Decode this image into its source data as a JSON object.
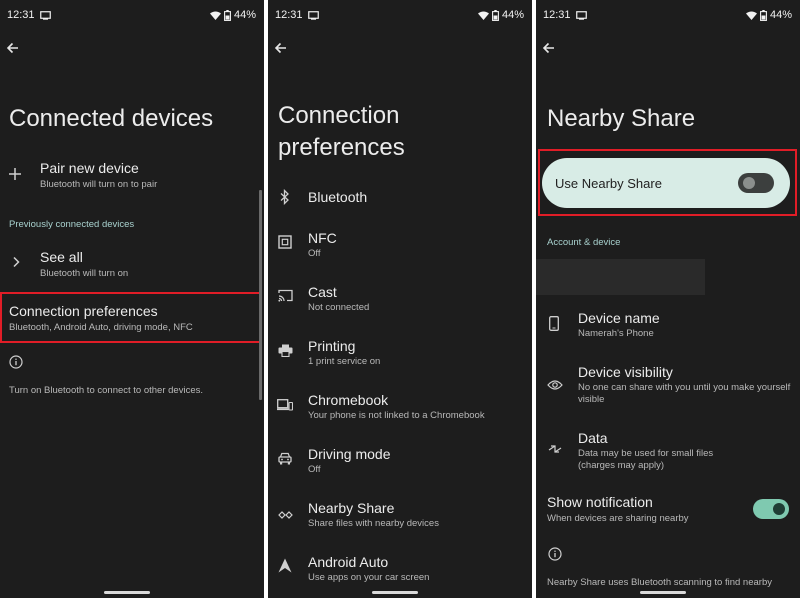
{
  "status": {
    "time": "12:31",
    "battery": "44%"
  },
  "panel1": {
    "title": "Connected devices",
    "pair": {
      "title": "Pair new device",
      "subtitle": "Bluetooth will turn on to pair"
    },
    "section_header": "Previously connected devices",
    "see_all": {
      "title": "See all",
      "subtitle": "Bluetooth will turn on"
    },
    "connection_prefs": {
      "title": "Connection preferences",
      "subtitle": "Bluetooth, Android Auto, driving mode, NFC"
    },
    "info_text": "Turn on Bluetooth to connect to other devices."
  },
  "panel2": {
    "title_line1": "Connection",
    "title_line2": "preferences",
    "items": [
      {
        "title": "Bluetooth",
        "subtitle": "",
        "icon": "bluetooth-icon"
      },
      {
        "title": "NFC",
        "subtitle": "Off",
        "icon": "nfc-icon"
      },
      {
        "title": "Cast",
        "subtitle": "Not connected",
        "icon": "cast-icon"
      },
      {
        "title": "Printing",
        "subtitle": "1 print service on",
        "icon": "printer-icon"
      },
      {
        "title": "Chromebook",
        "subtitle": "Your phone is not linked to a Chromebook",
        "icon": "chromebook-icon"
      },
      {
        "title": "Driving mode",
        "subtitle": "Off",
        "icon": "car-icon"
      },
      {
        "title": "Nearby Share",
        "subtitle": "Share files with nearby devices",
        "icon": "nearby-share-icon"
      },
      {
        "title": "Android Auto",
        "subtitle": "Use apps on your car screen",
        "icon": "android-auto-icon"
      }
    ]
  },
  "panel3": {
    "title": "Nearby Share",
    "use_label": "Use Nearby Share",
    "use_enabled": false,
    "section_header": "Account & device",
    "device_name": {
      "title": "Device name",
      "subtitle": "Namerah's Phone"
    },
    "visibility": {
      "title": "Device visibility",
      "subtitle_line1": "No one can share with you until you make yourself",
      "subtitle_line2": "visible"
    },
    "data": {
      "title": "Data",
      "subtitle_line1": "Data may be used for small files",
      "subtitle_line2": "(charges may apply)"
    },
    "notification": {
      "title": "Show notification",
      "subtitle": "When devices are sharing nearby",
      "enabled": true
    },
    "footer_text": "Nearby Share uses Bluetooth scanning to find nearby"
  },
  "colors": {
    "background": "#1d1d1d",
    "accent_teal": "#a9d2cf",
    "highlight": "#e11d27",
    "card": "#d8ece6",
    "toggle_on": "#7fc9b0"
  }
}
